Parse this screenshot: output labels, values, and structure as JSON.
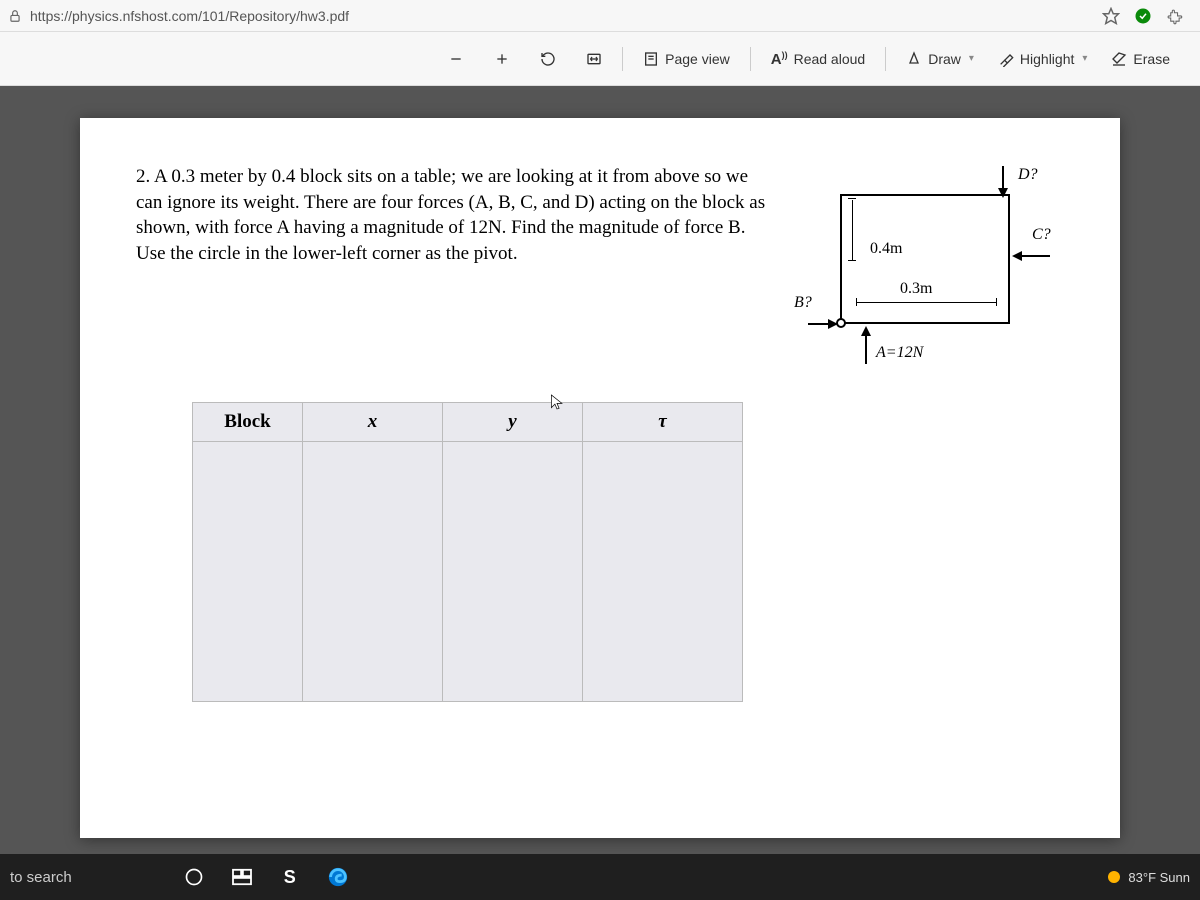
{
  "address": {
    "url": "https://physics.nfshost.com/101/Repository/hw3.pdf"
  },
  "toolbar": {
    "page_view": "Page view",
    "read_aloud": "Read aloud",
    "draw": "Draw",
    "highlight": "Highlight",
    "erase": "Erase"
  },
  "problem": {
    "text": "2. A 0.3 meter by 0.4 block sits on a table; we are looking at it from above so we can ignore its weight. There are four forces (A, B, C, and D) acting on the block as shown, with force A having a magnitude of 12N. Find the magnitude of force B. Use the circle in the lower-left corner as the pivot."
  },
  "diagram": {
    "width_label": "0.3m",
    "height_label": "0.4m",
    "A": "A=12N",
    "B": "B?",
    "C": "C?",
    "D": "D?"
  },
  "table": {
    "headers": [
      "Block",
      "x",
      "y",
      "τ"
    ]
  },
  "taskbar": {
    "search": "to search",
    "weather": "83°F Sunn"
  }
}
